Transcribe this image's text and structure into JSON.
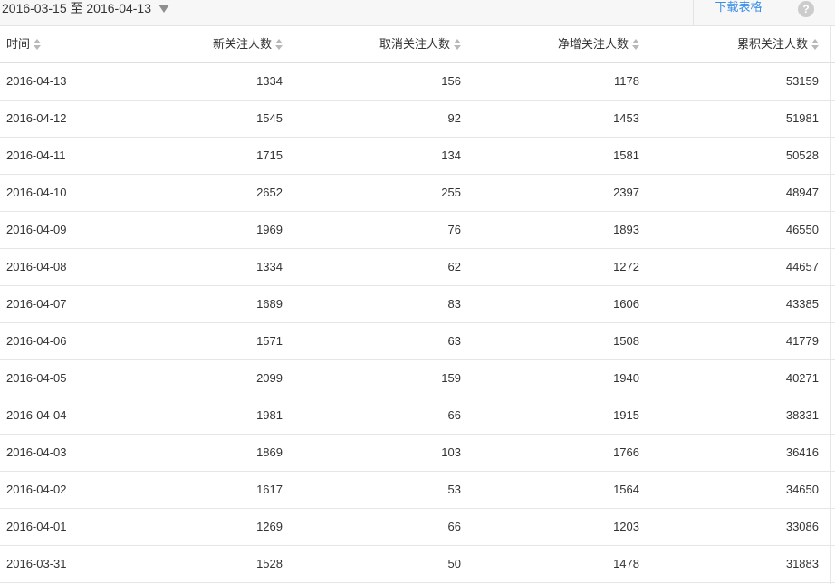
{
  "toolbar": {
    "date_range": "2016-03-15 至 2016-04-13",
    "download_label": "下载表格",
    "help_label": "?"
  },
  "table": {
    "columns": [
      "时间",
      "新关注人数",
      "取消关注人数",
      "净增关注人数",
      "累积关注人数"
    ],
    "rows": [
      [
        "2016-04-13",
        "1334",
        "156",
        "1178",
        "53159"
      ],
      [
        "2016-04-12",
        "1545",
        "92",
        "1453",
        "51981"
      ],
      [
        "2016-04-11",
        "1715",
        "134",
        "1581",
        "50528"
      ],
      [
        "2016-04-10",
        "2652",
        "255",
        "2397",
        "48947"
      ],
      [
        "2016-04-09",
        "1969",
        "76",
        "1893",
        "46550"
      ],
      [
        "2016-04-08",
        "1334",
        "62",
        "1272",
        "44657"
      ],
      [
        "2016-04-07",
        "1689",
        "83",
        "1606",
        "43385"
      ],
      [
        "2016-04-06",
        "1571",
        "63",
        "1508",
        "41779"
      ],
      [
        "2016-04-05",
        "2099",
        "159",
        "1940",
        "40271"
      ],
      [
        "2016-04-04",
        "1981",
        "66",
        "1915",
        "38331"
      ],
      [
        "2016-04-03",
        "1869",
        "103",
        "1766",
        "36416"
      ],
      [
        "2016-04-02",
        "1617",
        "53",
        "1564",
        "34650"
      ],
      [
        "2016-04-01",
        "1269",
        "66",
        "1203",
        "33086"
      ],
      [
        "2016-03-31",
        "1528",
        "50",
        "1478",
        "31883"
      ]
    ]
  },
  "colors": {
    "link": "#3a8ee6",
    "text": "#333333",
    "border": "#e6e6e6",
    "toolbar_bg": "#f7f7f7"
  }
}
